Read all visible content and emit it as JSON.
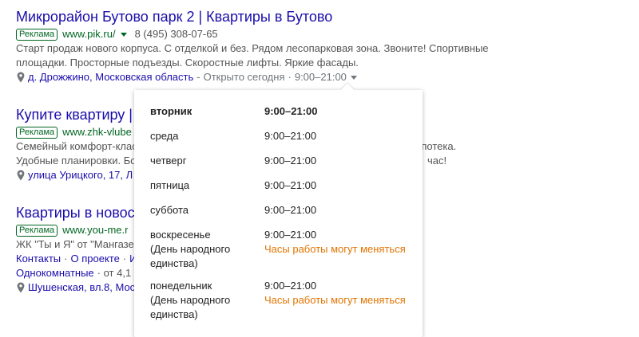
{
  "ads": [
    {
      "title": "Микрорайон Бутово парк 2 | Квартиры в Бутово",
      "badge": "Реклама",
      "url": "www.pik.ru/",
      "phone": "8 (495) 308-07-65",
      "description": "Старт продаж нового корпуса. С отделкой и без. Рядом лесопарковая зона. Звоните! Спортивные площадки. Просторные подъезды. Скоростные лифты. Яркие фасады.",
      "location": "д. Дрожжино, Московская область",
      "hours_status": "Открыто сегодня",
      "hours_today": "9:00–21:00"
    },
    {
      "title": "Купите квартиру | ЖК",
      "badge": "Реклама",
      "url": "www.zhk-vlube",
      "desc_left_1": "Семейный комфорт-клас",
      "desc_right_1": "Ипотека.",
      "desc_left_2": "Удобные планировки. Бо",
      "desc_right_2": "час!",
      "location": "улица Урицкого, 17, Л"
    },
    {
      "title": "Квартиры в новостройке",
      "badge": "Реклама",
      "url": "www.you-me.r",
      "desc_left": "ЖК \"Ты и Я\" от \"Мангазе",
      "sitelinks": [
        "Контакты",
        "О проекте",
        "И"
      ],
      "sitelink_sep": "·",
      "line2": "Однокомнатные",
      "line2_rest": "· от 4,1",
      "location": "Шушенская, вл.8, Мос"
    }
  ],
  "hours_popup": {
    "rows": [
      {
        "day": "вторник",
        "time": "9:00–21:00",
        "today": true
      },
      {
        "day": "среда",
        "time": "9:00–21:00"
      },
      {
        "day": "четверг",
        "time": "9:00–21:00"
      },
      {
        "day": "пятница",
        "time": "9:00–21:00"
      },
      {
        "day": "суббота",
        "time": "9:00–21:00"
      },
      {
        "day": "воскресенье",
        "day_note": "(День народного единства)",
        "time": "9:00–21:00",
        "note": "Часы работы могут меняться"
      },
      {
        "day": "понедельник",
        "day_note": "(День народного единства)",
        "time": "9:00–21:00",
        "note": "Часы работы могут меняться"
      }
    ]
  },
  "colors": {
    "title": "#1a0dab",
    "url": "#006621",
    "warning": "#e37400"
  }
}
